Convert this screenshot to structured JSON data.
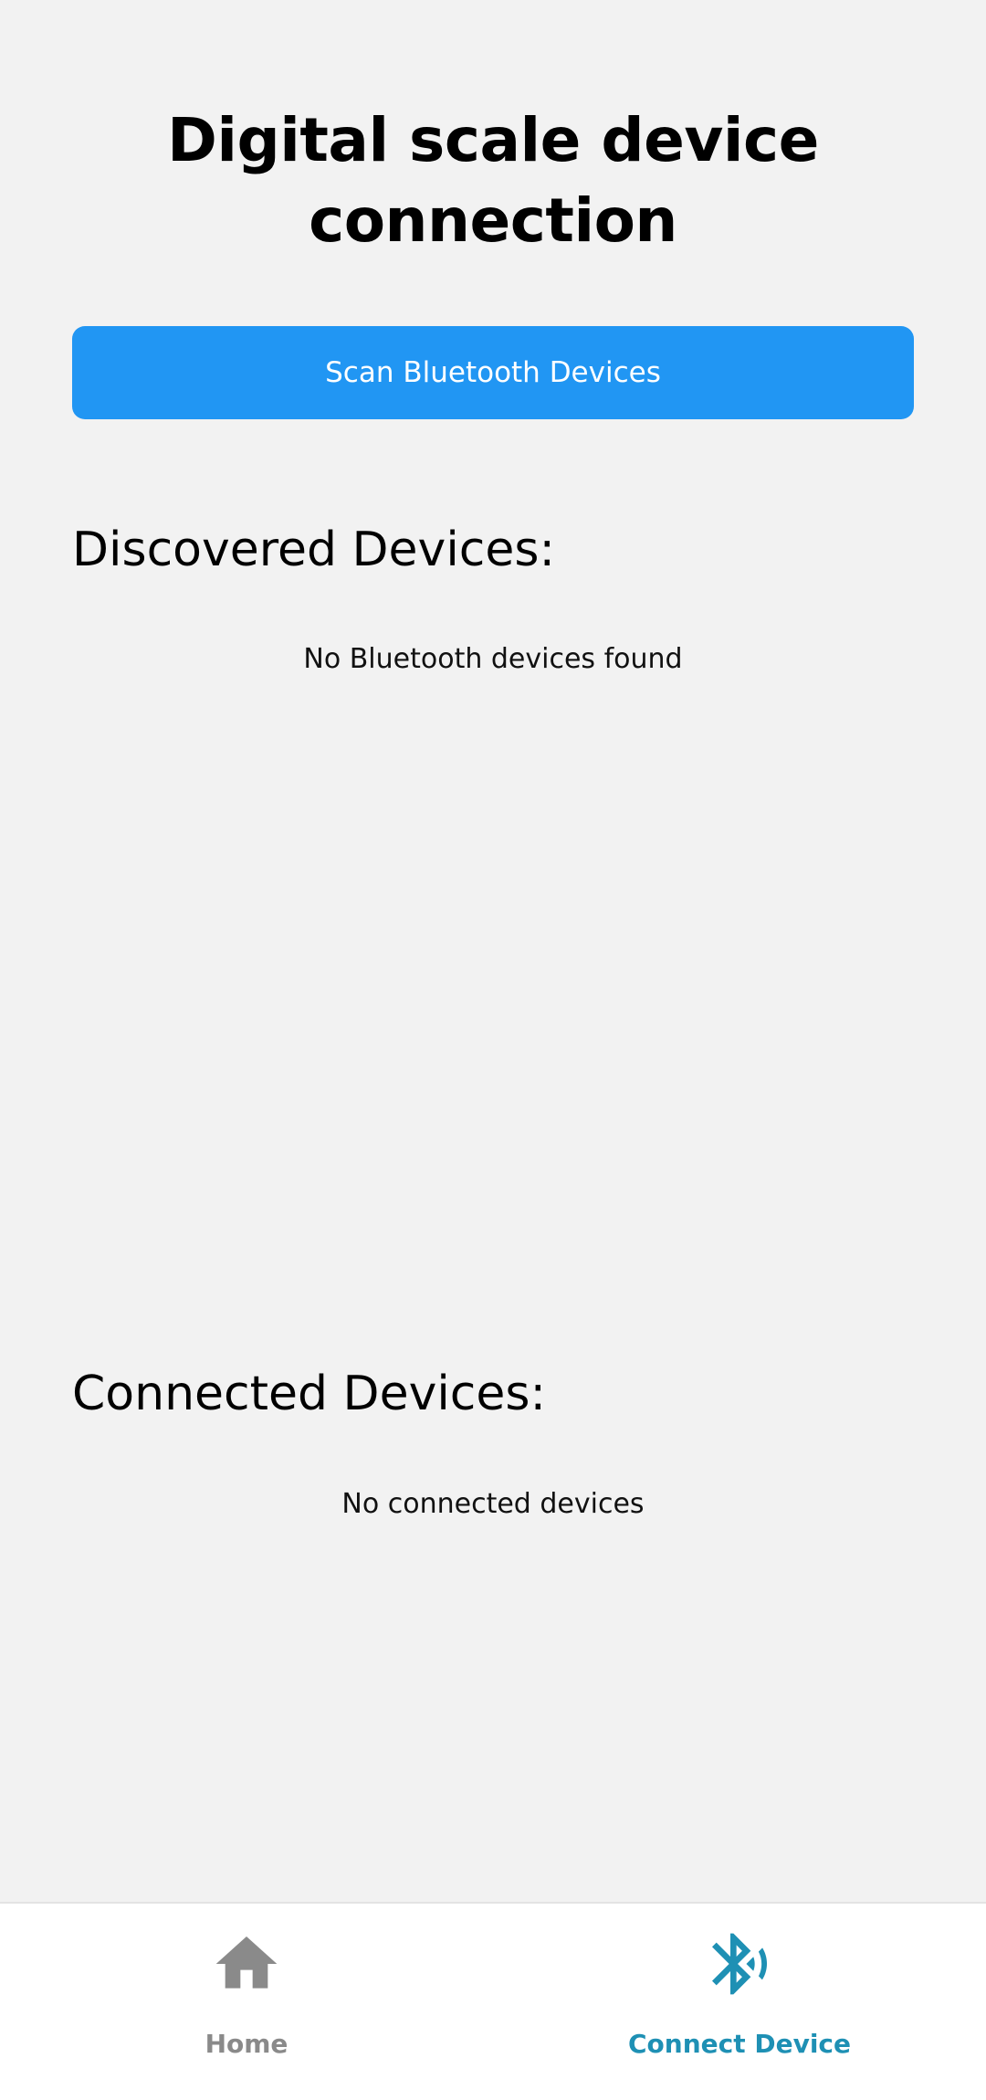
{
  "page": {
    "title": "Digital scale device connection",
    "scan_button_label": "Scan Bluetooth Devices"
  },
  "discovered": {
    "heading": "Discovered Devices:",
    "empty_message": "No Bluetooth devices found"
  },
  "connected": {
    "heading": "Connected Devices:",
    "empty_message": "No connected devices"
  },
  "bottom_nav": {
    "items": [
      {
        "label": "Home",
        "icon": "home-icon",
        "active": false
      },
      {
        "label": "Connect Device",
        "icon": "bluetooth-audio-icon",
        "active": true
      }
    ]
  },
  "colors": {
    "background": "#f2f2f2",
    "primary_button": "#2196f3",
    "active_tab": "#1e90b4",
    "inactive_tab": "#8a8a8a"
  }
}
